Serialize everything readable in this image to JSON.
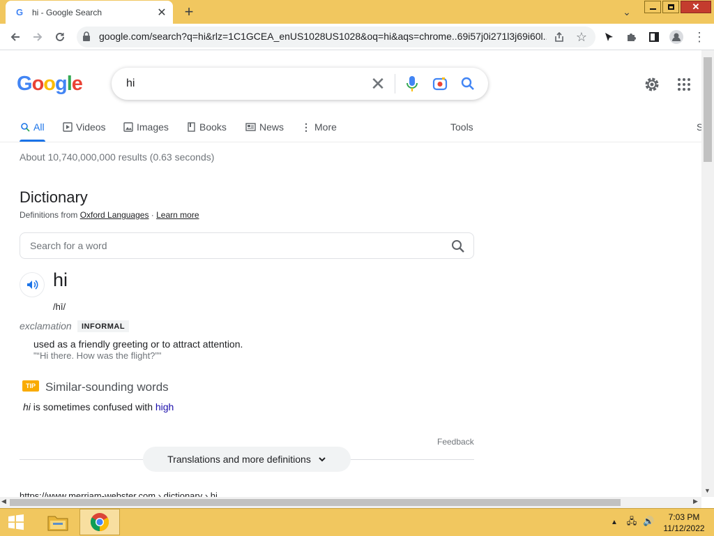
{
  "browser": {
    "tab_title": "hi - Google Search",
    "tab_favicon": "G",
    "new_tab": "+",
    "url": "google.com/search?q=hi&rlz=1C1GCEA_enUS1028US1028&oq=hi&aqs=chrome..69i57j0i271l3j69i60l...",
    "window_controls": {
      "minimize": "minimize-icon",
      "maximize": "restore-icon",
      "close": "✕"
    }
  },
  "google": {
    "logo": [
      "G",
      "o",
      "o",
      "g",
      "l",
      "e"
    ],
    "logo_colors": [
      "#4285f4",
      "#ea4335",
      "#fbbc05",
      "#4285f4",
      "#34a853",
      "#ea4335"
    ],
    "query": "hi",
    "nav_tabs": [
      "All",
      "Videos",
      "Images",
      "Books",
      "News",
      "More"
    ],
    "tools": "Tools",
    "right_clip": "S",
    "stats": "About 10,740,000,000 results (0.63 seconds)"
  },
  "dictionary": {
    "heading": "Dictionary",
    "defs_from_prefix": "Definitions from ",
    "oxford": "Oxford Languages",
    "sep": " · ",
    "learn_more": "Learn more",
    "search_placeholder": "Search for a word",
    "word": "hi",
    "phonetic": "/hī/",
    "part_of_speech": "exclamation",
    "register": "INFORMAL",
    "definition": "used as a friendly greeting or to attract attention.",
    "example": "\"“Hi there. How was the flight?”\"",
    "tip_badge": "TIP",
    "similar_heading": "Similar-sounding words",
    "similar_word": "hi",
    "similar_mid": " is sometimes confused with ",
    "similar_link": "high",
    "feedback": "Feedback",
    "more_button": "Translations and more definitions"
  },
  "next_result_cite": "https://www.merriam-webster.com › dictionary › hi",
  "taskbar": {
    "time": "7:03 PM",
    "date": "11/12/2022"
  },
  "colors": {
    "titlebar": "#f1c75f",
    "accent_blue": "#1a73e8",
    "link": "#1a0dab",
    "tip": "#f9ab00"
  }
}
